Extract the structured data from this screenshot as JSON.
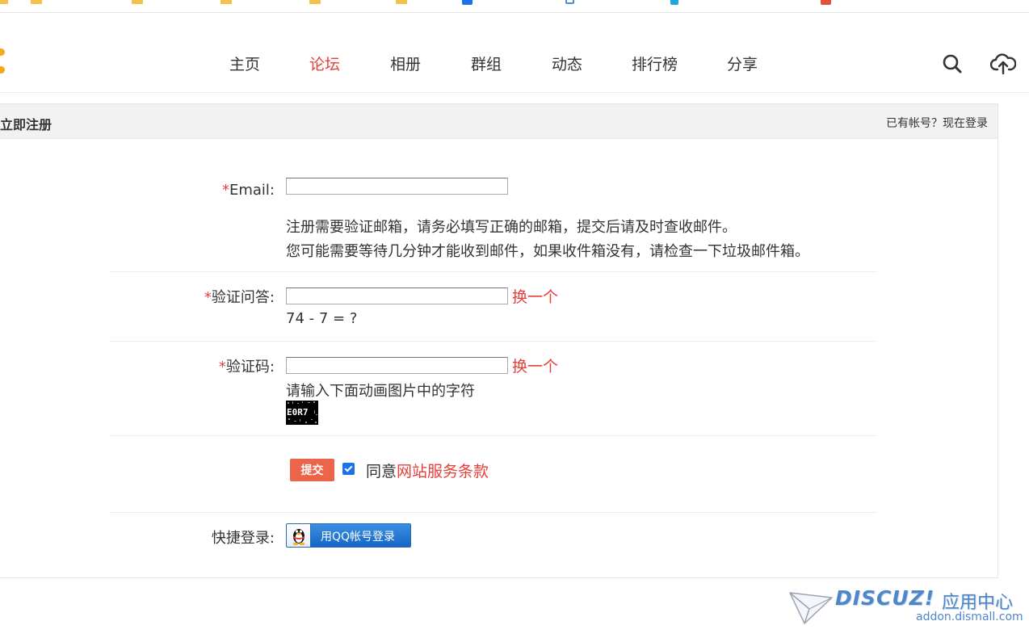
{
  "nav": {
    "items": [
      {
        "label": "主页",
        "active": false
      },
      {
        "label": "论坛",
        "active": true
      },
      {
        "label": "相册",
        "active": false
      },
      {
        "label": "群组",
        "active": false
      },
      {
        "label": "动态",
        "active": false
      },
      {
        "label": "排行榜",
        "active": false
      },
      {
        "label": "分享",
        "active": false
      }
    ],
    "active_color": "#e53f3a"
  },
  "header_icons": [
    "search-icon",
    "cloud-upload-icon"
  ],
  "panel": {
    "title": "立即注册",
    "login_link": "已有帐号？现在登录"
  },
  "form": {
    "email": {
      "required_mark": "*",
      "label": "Email:",
      "value": "",
      "hint_1": "注册需要验证邮箱，请务必填写正确的邮箱，提交后请及时查收邮件。",
      "hint_2": "您可能需要等待几分钟才能收到邮件，如果收件箱没有，请检查一下垃圾邮件箱。"
    },
    "question": {
      "required_mark": "*",
      "label": "验证问答:",
      "value": "",
      "change_label": "换一个",
      "question_text": "74 - 7 = ?"
    },
    "captcha": {
      "required_mark": "*",
      "label": "验证码:",
      "value": "",
      "change_label": "换一个",
      "hint": "请输入下面动画图片中的字符",
      "image_text": "E0R7"
    },
    "submit_label": "提交",
    "agree_checked": true,
    "agree_prefix": "同意",
    "terms_label": "网站服务条款",
    "quick_login_label": "快捷登录:",
    "qq_login_label": "用QQ帐号登录"
  },
  "watermark": {
    "brand": "DISCUZ!",
    "brand_cn": "应用中心",
    "url": "addon.dismall.com"
  },
  "colors": {
    "accent_red": "#e53f3a",
    "submit_bg": "#ec6449",
    "qq_blue": "#1566c7",
    "panel_head_bg": "#f2f2f2",
    "watermark_blue": "#4f86c9"
  }
}
